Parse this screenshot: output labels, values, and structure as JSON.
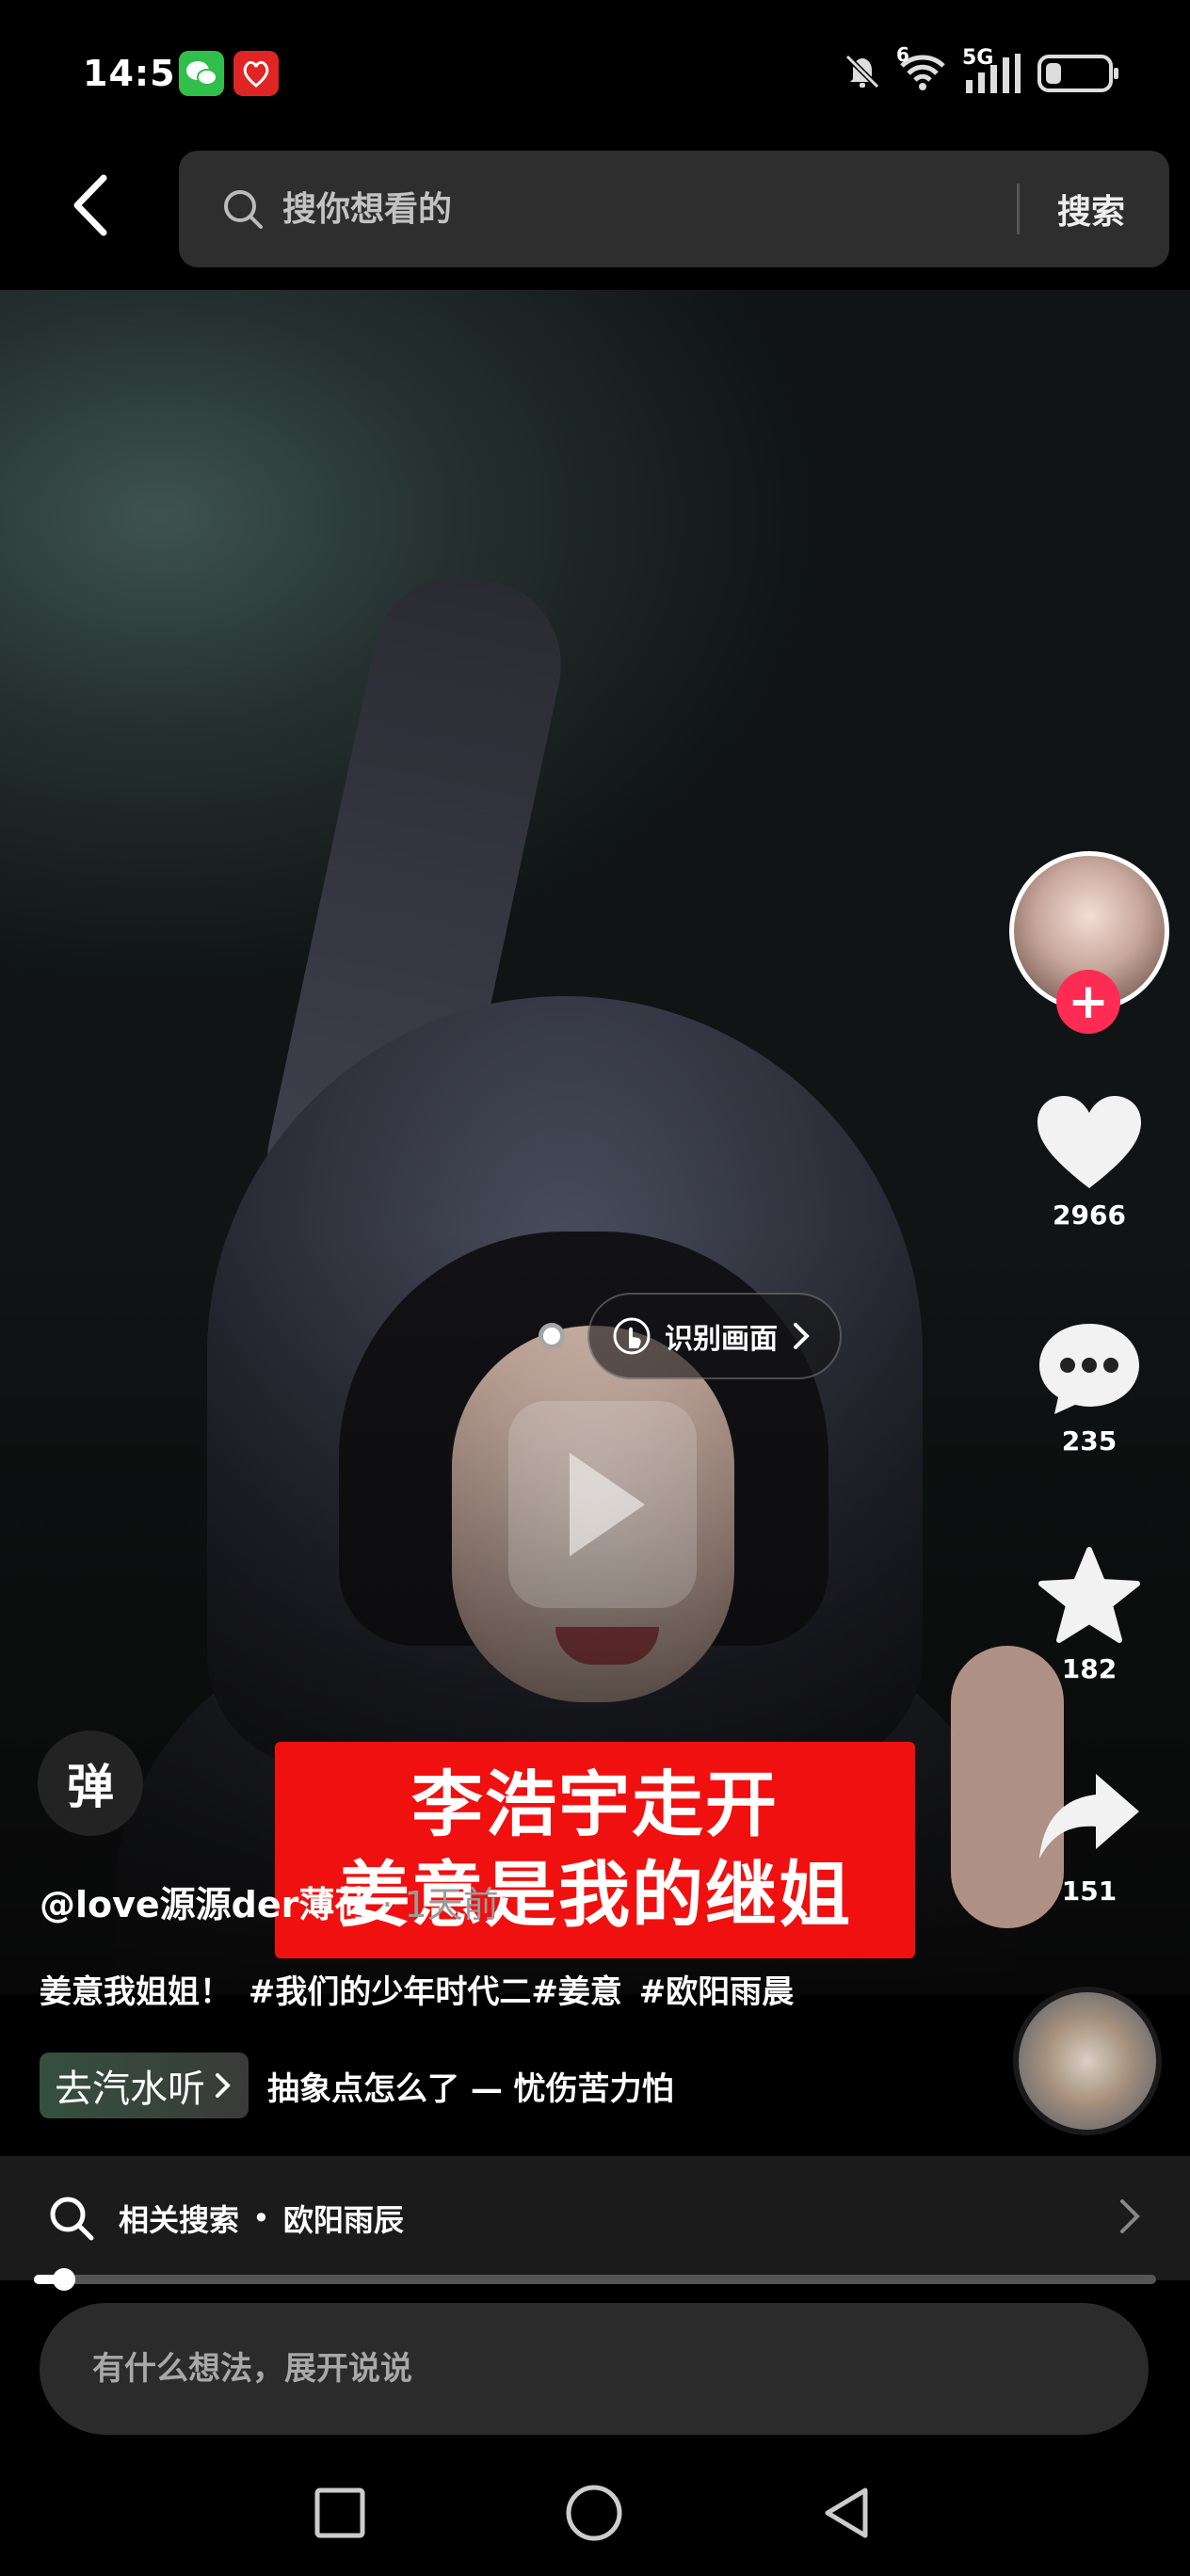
{
  "status_bar": {
    "time": "14:51",
    "network": "5G",
    "signal_badge": "6",
    "battery_level": 0.25,
    "icons": [
      "wechat-icon",
      "red-app-icon",
      "mute-icon",
      "wifi-icon",
      "signal-icon",
      "battery-icon"
    ]
  },
  "search": {
    "placeholder": "搜你想看的",
    "button_label": "搜索"
  },
  "video": {
    "recognize_label": "识别画面",
    "subtitle_lines": [
      "李浩宇走开",
      "姜意是我的继姐"
    ]
  },
  "creator": {
    "follow_symbol": "+"
  },
  "actions": {
    "likes": "2966",
    "comments": "235",
    "favorites": "182",
    "shares": "151"
  },
  "danmaku_label": "弹",
  "post": {
    "author": "@love源源der薄荷",
    "time_ago": "· 1天前",
    "caption": "姜意我姐姐！ #我们的少年时代二#姜意 #欧阳雨晨",
    "music_tag": "去汽水听",
    "music_title": "抽象点怎么了 — 忧伤苦力怕"
  },
  "related": {
    "label": "相关搜索",
    "separator": "•",
    "term": "欧阳雨辰"
  },
  "progress": 0.027,
  "comment": {
    "placeholder": "有什么想法，展开说说"
  },
  "colors": {
    "accent_red": "#fe2c55",
    "subtitle_bg": "#f01010",
    "search_bg": "#2e2e2e"
  }
}
